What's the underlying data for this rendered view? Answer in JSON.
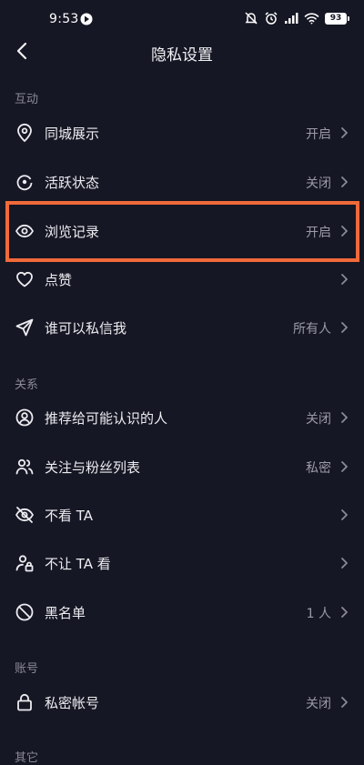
{
  "status": {
    "time": "9:53",
    "battery": "93"
  },
  "header": {
    "title": "隐私设置"
  },
  "sections": {
    "interaction": "互动",
    "relations": "关系",
    "account": "账号",
    "other": "其它"
  },
  "rows": [
    {
      "label": "同城展示",
      "value": "开启",
      "icon": "location-pin-icon"
    },
    {
      "label": "活跃状态",
      "value": "关闭",
      "icon": "activity-status-icon"
    },
    {
      "label": "浏览记录",
      "value": "开启",
      "icon": "eye-icon"
    },
    {
      "label": "点赞",
      "value": "",
      "icon": "heart-icon"
    },
    {
      "label": "谁可以私信我",
      "value": "所有人",
      "icon": "send-icon"
    },
    {
      "label": "推荐给可能认识的人",
      "value": "关闭",
      "icon": "user-circle-icon"
    },
    {
      "label": "关注与粉丝列表",
      "value": "私密",
      "icon": "users-icon"
    },
    {
      "label": "不看 TA",
      "value": "",
      "icon": "eye-off-icon"
    },
    {
      "label": "不让 TA 看",
      "value": "",
      "icon": "user-lock-icon"
    },
    {
      "label": "黑名单",
      "value": "1 人",
      "icon": "block-icon"
    },
    {
      "label": "私密帐号",
      "value": "关闭",
      "icon": "lock-icon"
    }
  ],
  "colors": {
    "background": "#161724",
    "highlight": "#f06a3a",
    "text": "#ececf1",
    "muted": "#9a9ba6"
  }
}
